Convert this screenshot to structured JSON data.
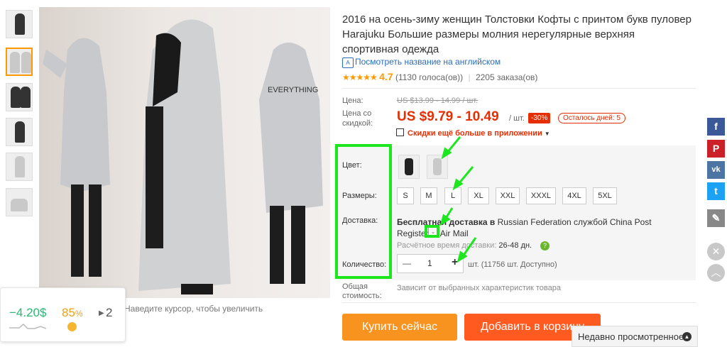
{
  "gallery": {
    "hover_hint": "Наведите курсор, чтобы увеличить",
    "thumbnail_count": 6
  },
  "widget": {
    "value": "−4.20$",
    "percent": "85",
    "percent_unit": "%",
    "count": "2"
  },
  "product": {
    "title": "2016 на осень-зиму женщин Толстовки Кофты с принтом букв пуловер Harajuku Большие размеры молния нерегулярные верхняя спортивная одежда",
    "english_link": "Посмотреть название на английском",
    "stars": "★★★★★",
    "score": "4.7",
    "votes": "(1130 голоса(ов))",
    "orders": "2205 заказа(ов)"
  },
  "pricing": {
    "price_label": "Цена:",
    "old_price": "US $13.99 - 14.99 / шт.",
    "discount_label": "Цена со скидкой:",
    "price": "US $9.79 - 10.49",
    "unit": "/ шт.",
    "discount": "-30%",
    "days_left": "Осталось дней: 5",
    "app_promo": "Скидки ещё больше в приложении"
  },
  "options": {
    "color_label": "Цвет:",
    "size_label": "Размеры:",
    "shipping_label": "Доставка:",
    "quantity_label": "Количество:",
    "total_label": "Общая стоимость:",
    "sizes": [
      "S",
      "M",
      "L",
      "XL",
      "XXL",
      "XXXL",
      "4XL",
      "5XL"
    ],
    "shipping_prefix": "Бесплатная доставка в",
    "shipping_text": " Russian Federation службой China Post Registered Air Mail",
    "shipping_time_label": "Расчётное время доставки:",
    "shipping_time": "26-48 дн.",
    "quantity": "1",
    "quantity_minus": "—",
    "quantity_plus": "+",
    "availability": "шт. (11756 шт. Доступно)",
    "total_value": "Зависит от выбранных характеристик товара"
  },
  "actions": {
    "buy": "Купить сейчас",
    "cart": "Добавить в корзину",
    "recent": "Недавно просмотренное"
  },
  "colors": {
    "accent": "#e62e04",
    "buy_button": "#f7931e",
    "cart_button": "#ff5a1f",
    "annotation": "#1ee61e",
    "link": "#2a6ebb"
  },
  "icons": {
    "social": [
      "facebook-icon",
      "pinterest-icon",
      "vk-icon",
      "twitter-icon",
      "edit-icon"
    ],
    "controls": [
      "close-icon",
      "chevron-up-icon"
    ]
  }
}
